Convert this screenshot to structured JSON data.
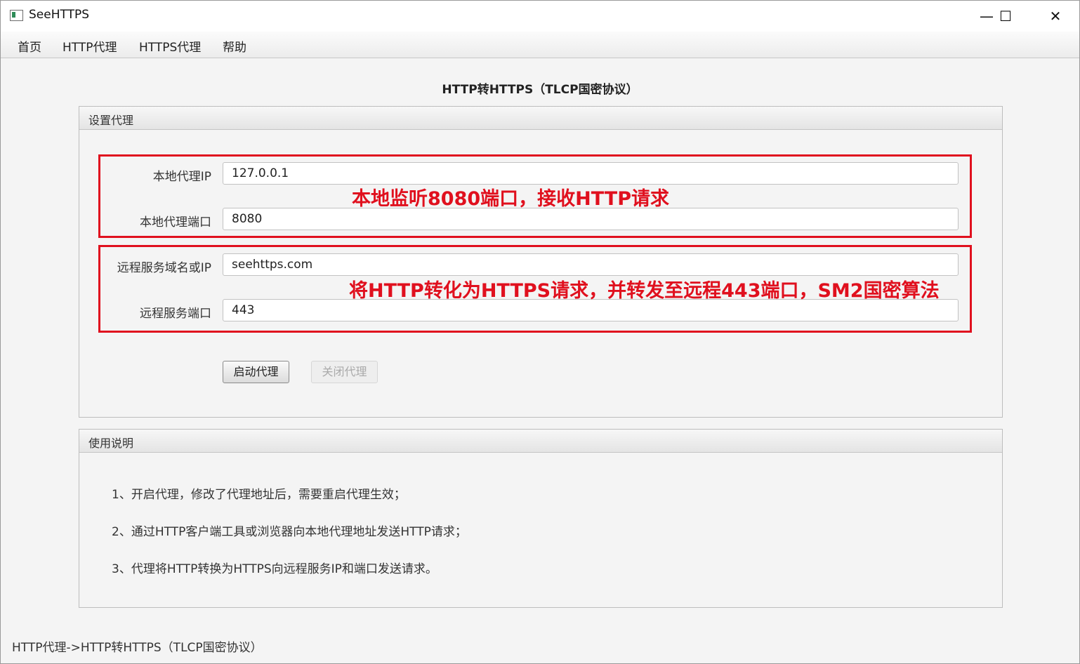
{
  "window": {
    "title": "SeeHTTPS",
    "minimize": "—",
    "maximize": "☐",
    "close": "✕"
  },
  "menu": [
    "首页",
    "HTTP代理",
    "HTTPS代理",
    "帮助"
  ],
  "page_title": "HTTP转HTTPS（TLCP国密协议）",
  "settings": {
    "header": "设置代理",
    "local_ip_label": "本地代理IP",
    "local_ip_value": "127.0.0.1",
    "local_port_label": "本地代理端口",
    "local_port_value": "8080",
    "remote_host_label": "远程服务域名或IP",
    "remote_host_value": "seehttps.com",
    "remote_port_label": "远程服务端口",
    "remote_port_value": "443",
    "start_button": "启动代理",
    "stop_button": "关闭代理"
  },
  "annotations": {
    "local": "本地监听8080端口，接收HTTP请求",
    "remote": "将HTTP转化为HTTPS请求，并转发至远程443端口，SM2国密算法"
  },
  "instructions": {
    "header": "使用说明",
    "items": [
      "1、开启代理，修改了代理地址后，需要重启代理生效；",
      "2、通过HTTP客户端工具或浏览器向本地代理地址发送HTTP请求；",
      "3、代理将HTTP转换为HTTPS向远程服务IP和端口发送请求。"
    ]
  },
  "status": "HTTP代理->HTTP转HTTPS（TLCP国密协议）",
  "colors": {
    "annotation": "#e0101e"
  }
}
